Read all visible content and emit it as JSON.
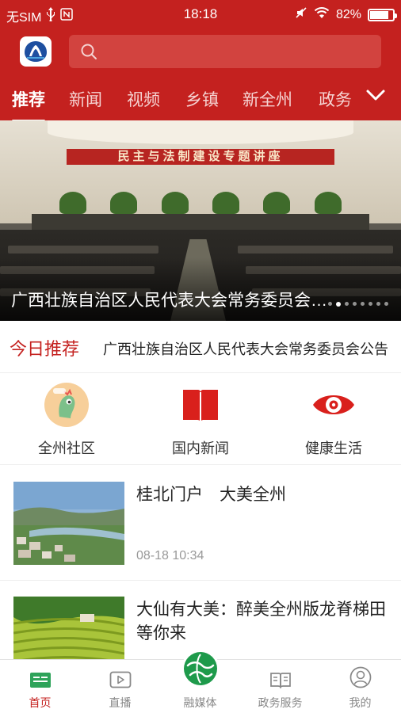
{
  "status_bar": {
    "carrier": "无SIM",
    "time": "18:18",
    "battery": "82%",
    "battery_level": 0.82
  },
  "header": {
    "search_placeholder": "",
    "tabs": [
      {
        "label": "推荐",
        "active": true
      },
      {
        "label": "新闻",
        "active": false
      },
      {
        "label": "视频",
        "active": false
      },
      {
        "label": "乡镇",
        "active": false
      },
      {
        "label": "新全州",
        "active": false
      },
      {
        "label": "政务",
        "active": false
      }
    ]
  },
  "banner": {
    "sign_text": "民主与法制建设专题讲座",
    "caption": "广西壮族自治区人民代表大会常务委员会公告",
    "dots_total": 8,
    "dot_active": 1
  },
  "today": {
    "label": "今日推荐",
    "text": "广西壮族自治区人民代表大会常务委员会公告"
  },
  "quick_links": [
    {
      "label": "全州社区",
      "icon": "community-mascot-icon"
    },
    {
      "label": "国内新闻",
      "icon": "book-icon"
    },
    {
      "label": "健康生活",
      "icon": "eye-icon"
    }
  ],
  "feed": [
    {
      "title": "桂北门户　大美全州",
      "time": "08-18 10:34"
    },
    {
      "title": "大仙有大美：醉美全州版龙脊梯田等你来",
      "time": ""
    }
  ],
  "bottom_nav": [
    {
      "label": "首页",
      "icon": "home-icon",
      "active": true
    },
    {
      "label": "直播",
      "icon": "live-icon",
      "active": false
    },
    {
      "label": "融媒体",
      "icon": "globe-icon",
      "active": false
    },
    {
      "label": "政务服务",
      "icon": "service-book-icon",
      "active": false
    },
    {
      "label": "我的",
      "icon": "profile-icon",
      "active": false
    }
  ],
  "colors": {
    "brand_red": "#c4211f",
    "nav_active": "#c4211f",
    "nav_inactive": "#888888",
    "globe_green": "#1e9a4b"
  }
}
